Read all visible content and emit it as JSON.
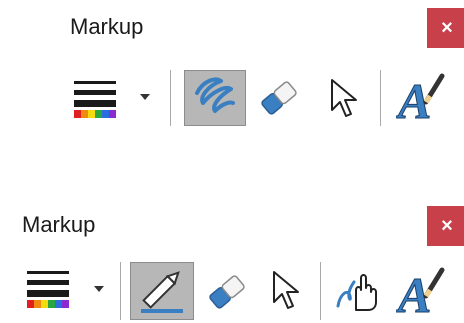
{
  "panel_top": {
    "title": "Markup",
    "close_label": "×",
    "tools": [
      {
        "name": "pen-color-thickness",
        "icon": "color-thickness-icon"
      },
      {
        "name": "dropdown",
        "icon": "chevron-down-icon"
      },
      {
        "name": "highlighter",
        "icon": "squiggle-pen-icon",
        "selected": true
      },
      {
        "name": "eraser",
        "icon": "eraser-icon"
      },
      {
        "name": "select",
        "icon": "cursor-arrow-icon"
      },
      {
        "name": "text-edit",
        "icon": "text-pen-icon"
      }
    ]
  },
  "panel_bottom": {
    "title": "Markup",
    "close_label": "×",
    "tools": [
      {
        "name": "pen-color-thickness",
        "icon": "color-thickness-icon"
      },
      {
        "name": "dropdown",
        "icon": "chevron-down-icon"
      },
      {
        "name": "pen",
        "icon": "pencil-icon",
        "selected": true
      },
      {
        "name": "eraser",
        "icon": "eraser-icon"
      },
      {
        "name": "select",
        "icon": "cursor-arrow-icon"
      },
      {
        "name": "ink-to-shape",
        "icon": "hand-stroke-icon"
      },
      {
        "name": "text-edit",
        "icon": "text-pen-icon"
      }
    ]
  },
  "colors": {
    "close_bg": "#c8404a",
    "selected_bg": "#b7b7b7",
    "ink_blue": "#3a7fc1"
  }
}
